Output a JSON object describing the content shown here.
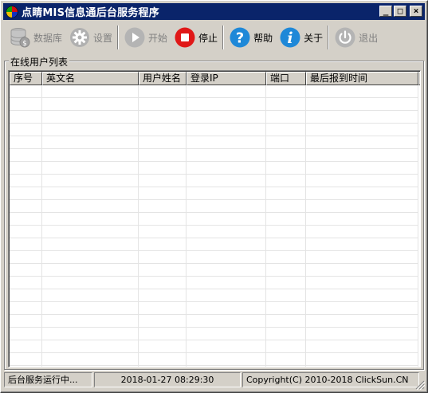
{
  "window": {
    "title": "点睛MIS信息通后台服务程序",
    "controls": {
      "minimize": "_",
      "maximize": "□",
      "close": "×"
    }
  },
  "toolbar": {
    "items": [
      {
        "label": "数据库",
        "icon": "database-icon",
        "enabled": false
      },
      {
        "label": "设置",
        "icon": "gear-icon",
        "enabled": false
      },
      {
        "label": "开始",
        "icon": "play-icon",
        "enabled": false
      },
      {
        "label": "停止",
        "icon": "stop-icon",
        "enabled": true
      },
      {
        "label": "帮助",
        "icon": "help-icon",
        "enabled": true
      },
      {
        "label": "关于",
        "icon": "info-icon",
        "enabled": true
      },
      {
        "label": "退出",
        "icon": "power-icon",
        "enabled": false
      }
    ]
  },
  "user_list": {
    "group_label": "在线用户列表",
    "columns": [
      "序号",
      "英文名",
      "用户姓名",
      "登录IP",
      "端口",
      "最后报到时间"
    ],
    "rows": []
  },
  "statusbar": {
    "status": "后台服务运行中...",
    "datetime": "2018-01-27 08:29:30",
    "copyright": "Copyright(C) 2010-2018 ClickSun.CN"
  },
  "colors": {
    "titlebar": "#0a246a",
    "stop_red": "#e01818",
    "help_blue": "#1e88d8",
    "disabled_gray": "#a8a8a8"
  }
}
